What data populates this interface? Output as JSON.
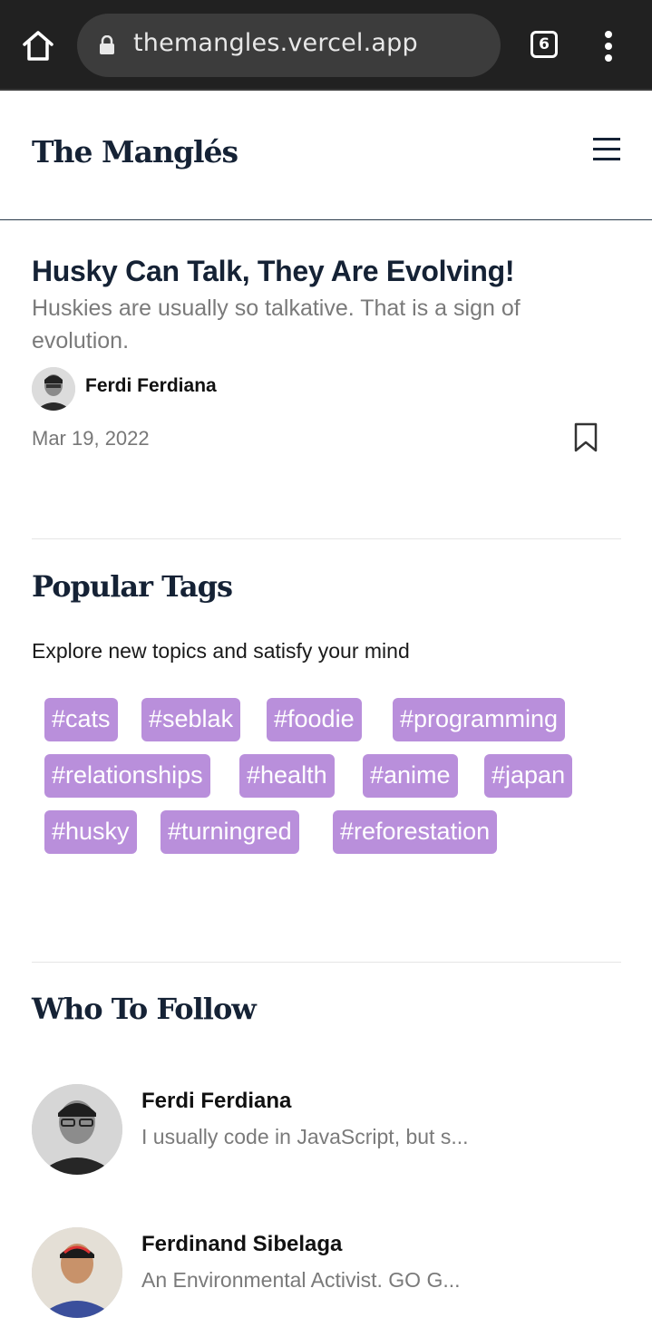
{
  "browser": {
    "url": "themangles.vercel.app",
    "tab_count": "6",
    "icons": [
      "home-icon",
      "lock-icon",
      "tab-switcher-icon",
      "more-vert-icon"
    ]
  },
  "header": {
    "brand": "The Manglés",
    "menu_icon": "hamburger-icon"
  },
  "article": {
    "title": "Husky Can Talk, They Are Evolving!",
    "summary": "Huskies are usually so talkative. That is a sign of evolution.",
    "author": "Ferdi Ferdiana",
    "date": "Mar 19, 2022",
    "bookmark_icon": "bookmark-icon"
  },
  "popular_tags": {
    "title": "Popular Tags",
    "subtitle": "Explore new topics and satisfy your mind",
    "tags": [
      "#cats",
      "#seblak",
      "#foodie",
      "#programming",
      "#relationships",
      "#health",
      "#anime",
      "#japan",
      "#husky",
      "#turningred",
      "#reforestation"
    ],
    "tag_color": "#b98fdb"
  },
  "who_to_follow": {
    "title": "Who To Follow",
    "people": [
      {
        "name": "Ferdi Ferdiana",
        "bio": "I usually code in JavaScript, but s..."
      },
      {
        "name": "Ferdinand Sibelaga",
        "bio": "An Environmental Activist. GO G..."
      }
    ]
  },
  "colors": {
    "browser_bar": "#212121",
    "url_pill": "#3c3c3c",
    "heading": "#152235",
    "muted": "#7a7a7a"
  }
}
